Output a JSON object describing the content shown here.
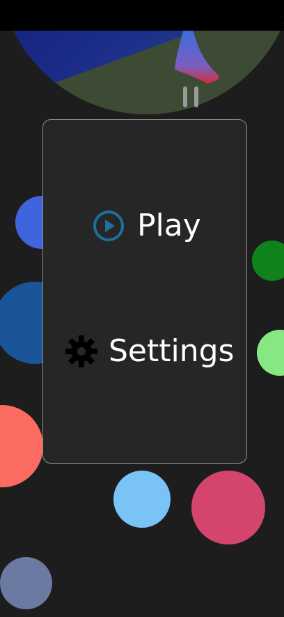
{
  "menu": {
    "play_label": "Play",
    "settings_label": "Settings"
  },
  "icons": {
    "play": "play-circle-icon",
    "settings": "gear-icon",
    "pause": "pause-icon"
  },
  "colors": {
    "background": "#1d1d1d",
    "panel": "#262626",
    "panel_border": "#8e8e8e",
    "play_icon": "#1f6f9c",
    "text": "#ffffff",
    "scene_navy": "#0b1462",
    "scene_olive": "#3c4a33"
  },
  "balls": [
    {
      "name": "ball-royal-blue",
      "color": "#4064dc"
    },
    {
      "name": "ball-steel-blue",
      "color": "#1a5597"
    },
    {
      "name": "ball-dark-green",
      "color": "#10821b"
    },
    {
      "name": "ball-light-green",
      "color": "#87e883"
    },
    {
      "name": "ball-salmon",
      "color": "#fb6b62"
    },
    {
      "name": "ball-sky-blue",
      "color": "#7ac3f7"
    },
    {
      "name": "ball-raspberry",
      "color": "#d4456e"
    },
    {
      "name": "ball-slate",
      "color": "#6b7aa2"
    }
  ]
}
